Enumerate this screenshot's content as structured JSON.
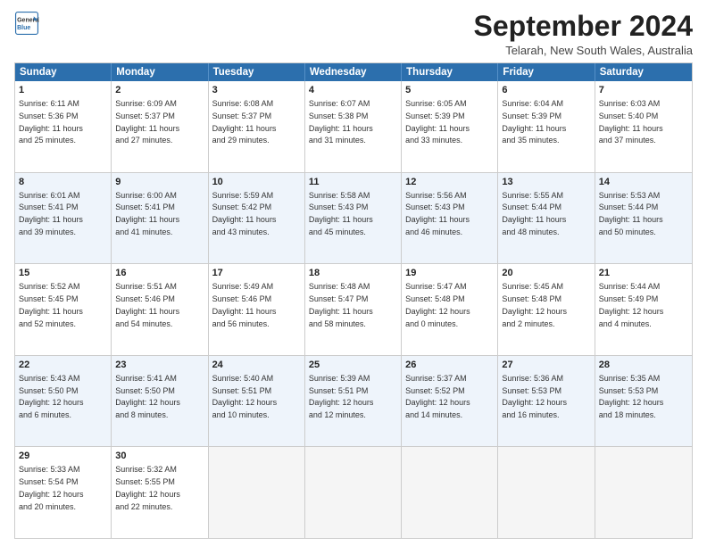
{
  "header": {
    "logo_line1": "General",
    "logo_line2": "Blue",
    "month_title": "September 2024",
    "location": "Telarah, New South Wales, Australia"
  },
  "weekdays": [
    "Sunday",
    "Monday",
    "Tuesday",
    "Wednesday",
    "Thursday",
    "Friday",
    "Saturday"
  ],
  "rows": [
    [
      {
        "day": "1",
        "lines": [
          "Sunrise: 6:11 AM",
          "Sunset: 5:36 PM",
          "Daylight: 11 hours",
          "and 25 minutes."
        ]
      },
      {
        "day": "2",
        "lines": [
          "Sunrise: 6:09 AM",
          "Sunset: 5:37 PM",
          "Daylight: 11 hours",
          "and 27 minutes."
        ]
      },
      {
        "day": "3",
        "lines": [
          "Sunrise: 6:08 AM",
          "Sunset: 5:37 PM",
          "Daylight: 11 hours",
          "and 29 minutes."
        ]
      },
      {
        "day": "4",
        "lines": [
          "Sunrise: 6:07 AM",
          "Sunset: 5:38 PM",
          "Daylight: 11 hours",
          "and 31 minutes."
        ]
      },
      {
        "day": "5",
        "lines": [
          "Sunrise: 6:05 AM",
          "Sunset: 5:39 PM",
          "Daylight: 11 hours",
          "and 33 minutes."
        ]
      },
      {
        "day": "6",
        "lines": [
          "Sunrise: 6:04 AM",
          "Sunset: 5:39 PM",
          "Daylight: 11 hours",
          "and 35 minutes."
        ]
      },
      {
        "day": "7",
        "lines": [
          "Sunrise: 6:03 AM",
          "Sunset: 5:40 PM",
          "Daylight: 11 hours",
          "and 37 minutes."
        ]
      }
    ],
    [
      {
        "day": "8",
        "lines": [
          "Sunrise: 6:01 AM",
          "Sunset: 5:41 PM",
          "Daylight: 11 hours",
          "and 39 minutes."
        ]
      },
      {
        "day": "9",
        "lines": [
          "Sunrise: 6:00 AM",
          "Sunset: 5:41 PM",
          "Daylight: 11 hours",
          "and 41 minutes."
        ]
      },
      {
        "day": "10",
        "lines": [
          "Sunrise: 5:59 AM",
          "Sunset: 5:42 PM",
          "Daylight: 11 hours",
          "and 43 minutes."
        ]
      },
      {
        "day": "11",
        "lines": [
          "Sunrise: 5:58 AM",
          "Sunset: 5:43 PM",
          "Daylight: 11 hours",
          "and 45 minutes."
        ]
      },
      {
        "day": "12",
        "lines": [
          "Sunrise: 5:56 AM",
          "Sunset: 5:43 PM",
          "Daylight: 11 hours",
          "and 46 minutes."
        ]
      },
      {
        "day": "13",
        "lines": [
          "Sunrise: 5:55 AM",
          "Sunset: 5:44 PM",
          "Daylight: 11 hours",
          "and 48 minutes."
        ]
      },
      {
        "day": "14",
        "lines": [
          "Sunrise: 5:53 AM",
          "Sunset: 5:44 PM",
          "Daylight: 11 hours",
          "and 50 minutes."
        ]
      }
    ],
    [
      {
        "day": "15",
        "lines": [
          "Sunrise: 5:52 AM",
          "Sunset: 5:45 PM",
          "Daylight: 11 hours",
          "and 52 minutes."
        ]
      },
      {
        "day": "16",
        "lines": [
          "Sunrise: 5:51 AM",
          "Sunset: 5:46 PM",
          "Daylight: 11 hours",
          "and 54 minutes."
        ]
      },
      {
        "day": "17",
        "lines": [
          "Sunrise: 5:49 AM",
          "Sunset: 5:46 PM",
          "Daylight: 11 hours",
          "and 56 minutes."
        ]
      },
      {
        "day": "18",
        "lines": [
          "Sunrise: 5:48 AM",
          "Sunset: 5:47 PM",
          "Daylight: 11 hours",
          "and 58 minutes."
        ]
      },
      {
        "day": "19",
        "lines": [
          "Sunrise: 5:47 AM",
          "Sunset: 5:48 PM",
          "Daylight: 12 hours",
          "and 0 minutes."
        ]
      },
      {
        "day": "20",
        "lines": [
          "Sunrise: 5:45 AM",
          "Sunset: 5:48 PM",
          "Daylight: 12 hours",
          "and 2 minutes."
        ]
      },
      {
        "day": "21",
        "lines": [
          "Sunrise: 5:44 AM",
          "Sunset: 5:49 PM",
          "Daylight: 12 hours",
          "and 4 minutes."
        ]
      }
    ],
    [
      {
        "day": "22",
        "lines": [
          "Sunrise: 5:43 AM",
          "Sunset: 5:50 PM",
          "Daylight: 12 hours",
          "and 6 minutes."
        ]
      },
      {
        "day": "23",
        "lines": [
          "Sunrise: 5:41 AM",
          "Sunset: 5:50 PM",
          "Daylight: 12 hours",
          "and 8 minutes."
        ]
      },
      {
        "day": "24",
        "lines": [
          "Sunrise: 5:40 AM",
          "Sunset: 5:51 PM",
          "Daylight: 12 hours",
          "and 10 minutes."
        ]
      },
      {
        "day": "25",
        "lines": [
          "Sunrise: 5:39 AM",
          "Sunset: 5:51 PM",
          "Daylight: 12 hours",
          "and 12 minutes."
        ]
      },
      {
        "day": "26",
        "lines": [
          "Sunrise: 5:37 AM",
          "Sunset: 5:52 PM",
          "Daylight: 12 hours",
          "and 14 minutes."
        ]
      },
      {
        "day": "27",
        "lines": [
          "Sunrise: 5:36 AM",
          "Sunset: 5:53 PM",
          "Daylight: 12 hours",
          "and 16 minutes."
        ]
      },
      {
        "day": "28",
        "lines": [
          "Sunrise: 5:35 AM",
          "Sunset: 5:53 PM",
          "Daylight: 12 hours",
          "and 18 minutes."
        ]
      }
    ],
    [
      {
        "day": "29",
        "lines": [
          "Sunrise: 5:33 AM",
          "Sunset: 5:54 PM",
          "Daylight: 12 hours",
          "and 20 minutes."
        ]
      },
      {
        "day": "30",
        "lines": [
          "Sunrise: 5:32 AM",
          "Sunset: 5:55 PM",
          "Daylight: 12 hours",
          "and 22 minutes."
        ]
      },
      {
        "day": "",
        "lines": []
      },
      {
        "day": "",
        "lines": []
      },
      {
        "day": "",
        "lines": []
      },
      {
        "day": "",
        "lines": []
      },
      {
        "day": "",
        "lines": []
      }
    ]
  ],
  "row_alt": [
    false,
    true,
    false,
    true,
    false
  ]
}
